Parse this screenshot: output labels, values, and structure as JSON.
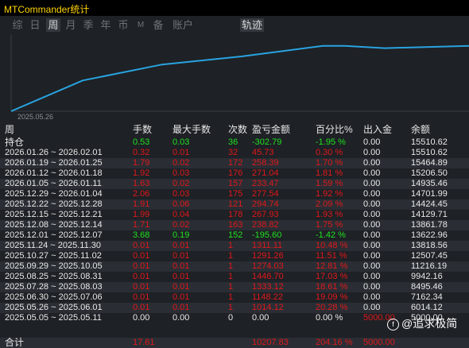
{
  "window": {
    "title": "MTCommander统计"
  },
  "tabs": [
    {
      "label": "综",
      "active": false
    },
    {
      "label": "日",
      "active": false
    },
    {
      "label": "周",
      "active": true
    },
    {
      "label": "月",
      "active": false
    },
    {
      "label": "季",
      "active": false
    },
    {
      "label": "年",
      "active": false
    },
    {
      "label": "币",
      "active": false
    },
    {
      "label": "M",
      "active": false
    },
    {
      "label": "备",
      "active": false
    },
    {
      "label": "账户",
      "active": false
    }
  ],
  "chart_tab": {
    "label": "轨迹",
    "active": true
  },
  "chart_data": {
    "type": "line",
    "x_label_first": "2025.05.26",
    "series": [
      {
        "values": [
          5000,
          9942.16,
          12507.45,
          13818.56,
          15510.62,
          15510.62,
          15150,
          15510.62
        ]
      }
    ],
    "color": "#29a3e0"
  },
  "table": {
    "headers": [
      "周",
      "手数",
      "最大手数",
      "次数",
      "盈亏金额",
      "百分比%",
      "出入金",
      "余额"
    ],
    "position_row": {
      "label": "持仓",
      "lots": "0.53",
      "max_lots": "0.03",
      "count": "36",
      "pnl": "-302.79",
      "percent": "-1.95 %",
      "inout": "0.00",
      "balance": "15510.62",
      "color": "green"
    },
    "rows": [
      {
        "label": "2026.01.26 ~ 2026.02.01",
        "lots": "0.32",
        "max_lots": "0.01",
        "count": "32",
        "pnl": "45.73",
        "percent": "0.30 %",
        "inout": "0.00",
        "balance": "15510.62",
        "color": "red"
      },
      {
        "label": "2026.01.19 ~ 2026.01.25",
        "lots": "1.79",
        "max_lots": "0.02",
        "count": "172",
        "pnl": "258.39",
        "percent": "1.70 %",
        "inout": "0.00",
        "balance": "15464.89",
        "color": "red"
      },
      {
        "label": "2026.01.12 ~ 2026.01.18",
        "lots": "1.92",
        "max_lots": "0.03",
        "count": "176",
        "pnl": "271.04",
        "percent": "1.81 %",
        "inout": "0.00",
        "balance": "15206.50",
        "color": "red"
      },
      {
        "label": "2026.01.05 ~ 2026.01.11",
        "lots": "1.63",
        "max_lots": "0.02",
        "count": "157",
        "pnl": "233.47",
        "percent": "1.59 %",
        "inout": "0.00",
        "balance": "14935.46",
        "color": "red"
      },
      {
        "label": "2025.12.29 ~ 2026.01.04",
        "lots": "2.06",
        "max_lots": "0.03",
        "count": "175",
        "pnl": "277.54",
        "percent": "1.92 %",
        "inout": "0.00",
        "balance": "14701.99",
        "color": "red"
      },
      {
        "label": "2025.12.22 ~ 2025.12.28",
        "lots": "1.91",
        "max_lots": "0.06",
        "count": "121",
        "pnl": "294.74",
        "percent": "2.09 %",
        "inout": "0.00",
        "balance": "14424.45",
        "color": "red"
      },
      {
        "label": "2025.12.15 ~ 2025.12.21",
        "lots": "1.99",
        "max_lots": "0.04",
        "count": "178",
        "pnl": "267.93",
        "percent": "1.93 %",
        "inout": "0.00",
        "balance": "14129.71",
        "color": "red"
      },
      {
        "label": "2025.12.08 ~ 2025.12.14",
        "lots": "1.71",
        "max_lots": "0.02",
        "count": "163",
        "pnl": "238.82",
        "percent": "1.75 %",
        "inout": "0.00",
        "balance": "13861.78",
        "color": "red"
      },
      {
        "label": "2025.12.01 ~ 2025.12.07",
        "lots": "3.68",
        "max_lots": "0.19",
        "count": "152",
        "pnl": "-195.60",
        "percent": "-1.42 %",
        "inout": "0.00",
        "balance": "13622.96",
        "color": "green"
      },
      {
        "label": "2025.11.24 ~ 2025.11.30",
        "lots": "0.01",
        "max_lots": "0.01",
        "count": "1",
        "pnl": "1311.11",
        "percent": "10.48 %",
        "inout": "0.00",
        "balance": "13818.56",
        "color": "red"
      },
      {
        "label": "2025.10.27 ~ 2025.11.02",
        "lots": "0.01",
        "max_lots": "0.01",
        "count": "1",
        "pnl": "1291.26",
        "percent": "11.51 %",
        "inout": "0.00",
        "balance": "12507.45",
        "color": "red"
      },
      {
        "label": "2025.09.29 ~ 2025.10.05",
        "lots": "0.01",
        "max_lots": "0.01",
        "count": "1",
        "pnl": "1274.03",
        "percent": "12.81 %",
        "inout": "0.00",
        "balance": "11216.19",
        "color": "red"
      },
      {
        "label": "2025.08.25 ~ 2025.08.31",
        "lots": "0.01",
        "max_lots": "0.01",
        "count": "1",
        "pnl": "1446.70",
        "percent": "17.03 %",
        "inout": "0.00",
        "balance": "9942.16",
        "color": "red"
      },
      {
        "label": "2025.07.28 ~ 2025.08.03",
        "lots": "0.01",
        "max_lots": "0.01",
        "count": "1",
        "pnl": "1333.12",
        "percent": "18.61 %",
        "inout": "0.00",
        "balance": "8495.46",
        "color": "red"
      },
      {
        "label": "2025.06.30 ~ 2025.07.06",
        "lots": "0.01",
        "max_lots": "0.01",
        "count": "1",
        "pnl": "1148.22",
        "percent": "19.09 %",
        "inout": "0.00",
        "balance": "7162.34",
        "color": "red"
      },
      {
        "label": "2025.05.26 ~ 2025.06.01",
        "lots": "0.01",
        "max_lots": "0.01",
        "count": "1",
        "pnl": "1014.12",
        "percent": "20.28 %",
        "inout": "0.00",
        "balance": "6014.12",
        "color": "red"
      },
      {
        "label": "2025.05.05 ~ 2025.05.11",
        "lots": "0.00",
        "max_lots": "0.00",
        "count": "0",
        "pnl": "0.00",
        "percent": "0.00 %",
        "inout": "5000.00",
        "balance": "5000.00",
        "color": "white",
        "inout_color": "red"
      }
    ],
    "total_row": {
      "label": "合计",
      "lots": "17.61",
      "pnl": "10207.83",
      "percent": "204.16 %",
      "inout": "5000.00"
    }
  },
  "watermark": {
    "text": "@追求极简"
  },
  "colors": {
    "red": "#e0181b",
    "green": "#20e020",
    "line": "#29a3e0",
    "title": "#ffd400"
  }
}
